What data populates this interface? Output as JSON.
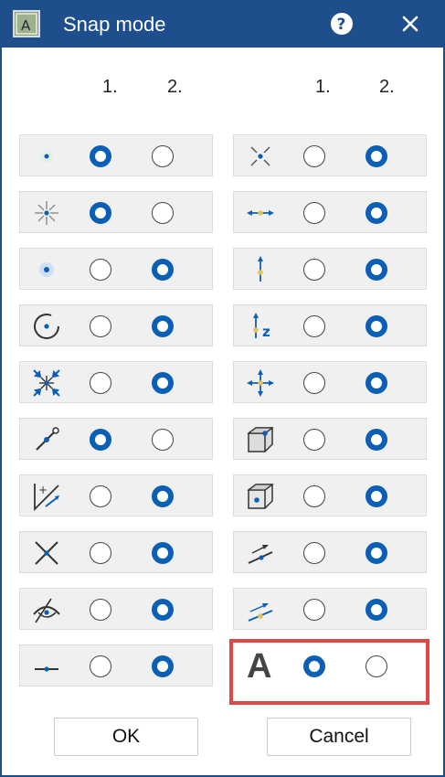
{
  "window": {
    "title": "Snap mode"
  },
  "headers": {
    "left_col1": "1.",
    "left_col2": "2.",
    "right_col1": "1.",
    "right_col2": "2."
  },
  "left_rows": [
    {
      "icon": "point-icon",
      "selected": 1
    },
    {
      "icon": "midpoint-star-icon",
      "selected": 1
    },
    {
      "icon": "center-point-icon",
      "selected": 2
    },
    {
      "icon": "circle-center-icon",
      "selected": 2
    },
    {
      "icon": "intersection-arrows-icon",
      "selected": 2
    },
    {
      "icon": "line-endpoint-icon",
      "selected": 1
    },
    {
      "icon": "angle-plus-icon",
      "selected": 2
    },
    {
      "icon": "cross-intersection-icon",
      "selected": 2
    },
    {
      "icon": "eye-visible-icon",
      "selected": 2
    },
    {
      "icon": "line-point-icon",
      "selected": 2
    }
  ],
  "right_rows": [
    {
      "icon": "x-point-icon",
      "selected": 2
    },
    {
      "icon": "horizontal-dimension-icon",
      "selected": 2
    },
    {
      "icon": "vertical-dimension-icon",
      "selected": 2
    },
    {
      "icon": "z-dimension-icon",
      "selected": 2
    },
    {
      "icon": "four-arrows-icon",
      "selected": 2
    },
    {
      "icon": "cube-corner-icon",
      "selected": 2
    },
    {
      "icon": "cube-face-icon",
      "selected": 2
    },
    {
      "icon": "parallel-arrow-icon",
      "selected": 2
    },
    {
      "icon": "parallel-lines-icon",
      "selected": 2
    },
    {
      "icon": "text-a-icon",
      "selected": 1,
      "label": "A"
    }
  ],
  "buttons": {
    "ok": "OK",
    "cancel": "Cancel"
  },
  "colors": {
    "titlebar": "#1f4e8c",
    "radio_selected": "#0b5fb5",
    "highlight": "#e04848",
    "snap_dot": "#e2c25c"
  }
}
